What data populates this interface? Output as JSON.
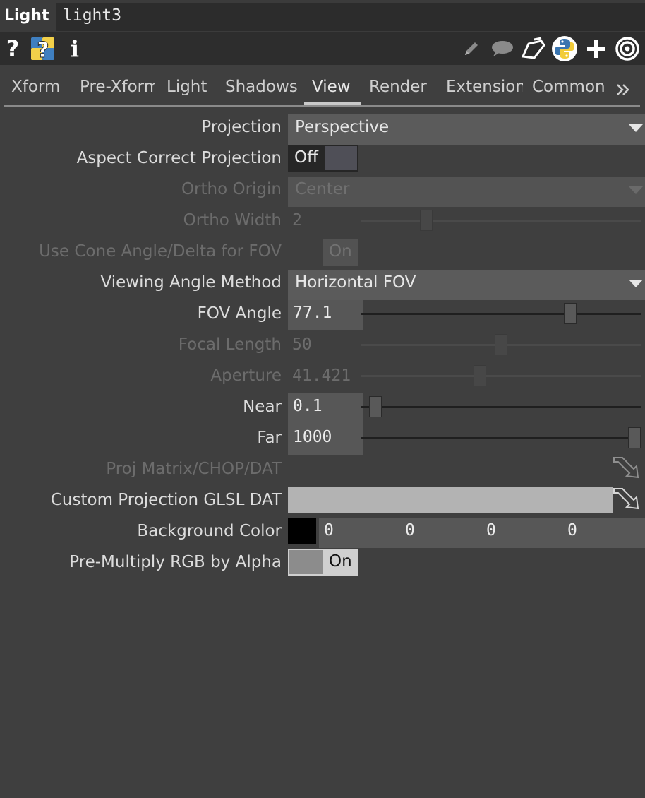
{
  "header": {
    "op_type": "Light",
    "op_name": "light3"
  },
  "toolbar": {
    "left_icons": [
      "help-icon",
      "python-help-icon",
      "info-icon"
    ],
    "right_icons": [
      "edit-icon",
      "comment-icon",
      "clone-icon",
      "python-icon",
      "add-icon",
      "target-icon"
    ]
  },
  "tabs": [
    {
      "label": "Xform"
    },
    {
      "label": "Pre-Xform"
    },
    {
      "label": "Light"
    },
    {
      "label": "Shadows"
    },
    {
      "label": "View"
    },
    {
      "label": "Render"
    },
    {
      "label": "Extensions"
    },
    {
      "label": "Common"
    }
  ],
  "active_tab": "View",
  "params": {
    "projection": {
      "label": "Projection",
      "value": "Perspective"
    },
    "aspect_correct": {
      "label": "Aspect Correct Projection",
      "value": "Off"
    },
    "ortho_origin": {
      "label": "Ortho Origin",
      "value": "Center"
    },
    "ortho_width": {
      "label": "Ortho Width",
      "value": "2"
    },
    "use_cone": {
      "label": "Use Cone Angle/Delta for FOV",
      "value": "On"
    },
    "view_angle_method": {
      "label": "Viewing Angle Method",
      "value": "Horizontal FOV"
    },
    "fov_angle": {
      "label": "FOV Angle",
      "value": "77.1"
    },
    "focal_length": {
      "label": "Focal Length",
      "value": "50"
    },
    "aperture": {
      "label": "Aperture",
      "value": "41.421"
    },
    "near": {
      "label": "Near",
      "value": "0.1"
    },
    "far": {
      "label": "Far",
      "value": "1000"
    },
    "proj_matrix": {
      "label": "Proj Matrix/CHOP/DAT",
      "value": ""
    },
    "custom_proj": {
      "label": "Custom Projection GLSL DAT",
      "value": ""
    },
    "bg_color": {
      "label": "Background Color",
      "swatch": "#000000",
      "r": "0",
      "g": "0",
      "b": "0",
      "a": "0"
    },
    "premultiply": {
      "label": "Pre-Multiply RGB by Alpha",
      "value": "On"
    }
  },
  "slider_levels": {
    "ortho_width": 0.22,
    "fov_angle": 0.76,
    "focal_length": 0.5,
    "aperture": 0.42,
    "near": 0.03,
    "far": 1.0
  }
}
